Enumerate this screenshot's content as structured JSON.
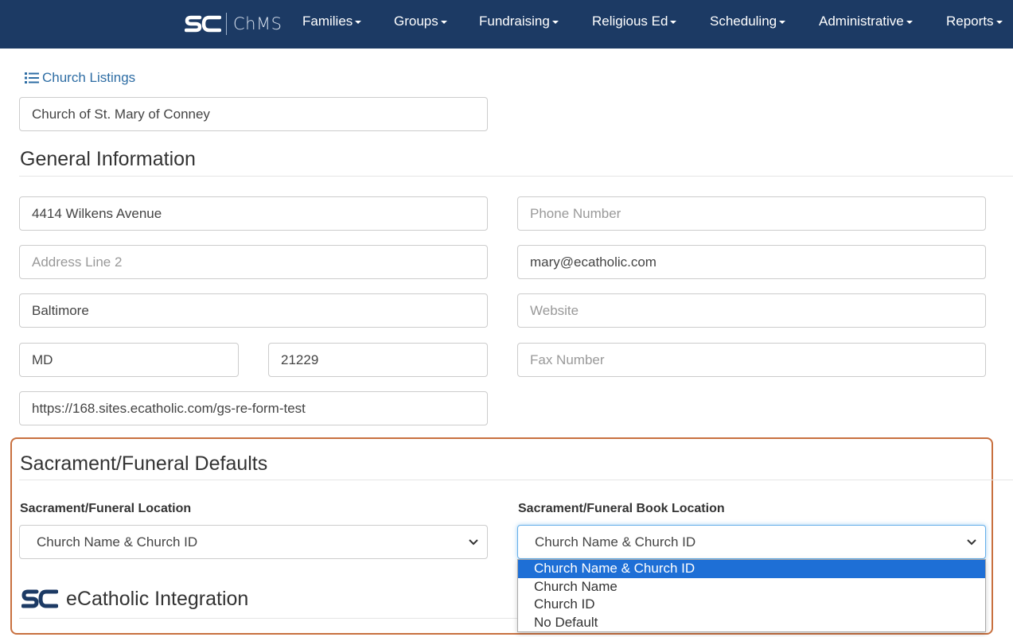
{
  "navbar": {
    "brand_text": "ChMS",
    "items": [
      {
        "label": "Families"
      },
      {
        "label": "Groups"
      },
      {
        "label": "Fundraising"
      },
      {
        "label": "Religious Ed"
      },
      {
        "label": "Scheduling"
      },
      {
        "label": "Administrative"
      },
      {
        "label": "Reports"
      }
    ],
    "bg_color": "#1c3a64"
  },
  "listings_link": "Church Listings",
  "church_name": "Church of St. Mary of Conney",
  "general": {
    "title": "General Information",
    "address1": "4414 Wilkens Avenue",
    "address2_placeholder": "Address Line 2",
    "city": "Baltimore",
    "state": "MD",
    "zip": "21229",
    "url": "https://168.sites.ecatholic.com/gs-re-form-test",
    "phone_placeholder": "Phone Number",
    "email": "mary@ecatholic.com",
    "website_placeholder": "Website",
    "fax_placeholder": "Fax Number"
  },
  "sacrament": {
    "title": "Sacrament/Funeral Defaults",
    "location_label": "Sacrament/Funeral Location",
    "location_value": "Church Name & Church ID",
    "book_label": "Sacrament/Funeral Book Location",
    "book_value": "Church Name & Church ID",
    "options": [
      "Church Name & Church ID",
      "Church Name",
      "Church ID",
      "No Default"
    ],
    "highlight_color": "#c8703f"
  },
  "ecatholic": {
    "title": "eCatholic Integration"
  }
}
